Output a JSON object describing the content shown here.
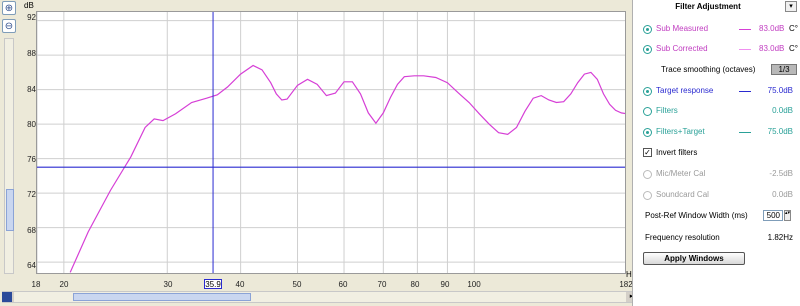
{
  "y_axis": {
    "unit": "dB",
    "ticks": [
      "92",
      "88",
      "84",
      "80",
      "76",
      "72",
      "68",
      "64"
    ]
  },
  "x_axis": {
    "unit": "Hz",
    "ticks": [
      "18",
      "20",
      "30",
      "40",
      "50",
      "60",
      "70",
      "80",
      "90",
      "100",
      "182"
    ]
  },
  "cursor_readout": "35.9",
  "chart_data": {
    "type": "line",
    "title": "",
    "xlabel": "Hz",
    "ylabel": "dB",
    "xlim": [
      18,
      182
    ],
    "ylim": [
      62.5,
      93
    ],
    "x_scale": "log",
    "series": [
      {
        "name": "Sub Measured",
        "color": "#d63fd6",
        "x": [
          20.5,
          22,
          24,
          26,
          27.5,
          28.5,
          29.5,
          31,
          33,
          35,
          36.5,
          38,
          40,
          42,
          43.5,
          45,
          46,
          47,
          48,
          50,
          52,
          54,
          56,
          58,
          60,
          62,
          64,
          66,
          68,
          70,
          72,
          74,
          76,
          79,
          82,
          86,
          90,
          94,
          98,
          102,
          106,
          110,
          114,
          118,
          122,
          126,
          130,
          134,
          138,
          142,
          146,
          150,
          154,
          158,
          162,
          166,
          170,
          174,
          178,
          182
        ],
        "y": [
          62.8,
          67.5,
          72.3,
          76.2,
          79.6,
          80.6,
          80.4,
          81.2,
          82.5,
          83.0,
          83.4,
          84.3,
          85.8,
          86.8,
          86.3,
          84.8,
          83.5,
          82.8,
          82.9,
          84.5,
          85.2,
          84.6,
          83.3,
          83.6,
          84.9,
          84.9,
          83.5,
          81.3,
          80.1,
          81.3,
          83.1,
          84.6,
          85.5,
          85.6,
          85.6,
          85.4,
          84.8,
          83.6,
          82.5,
          81.2,
          80.0,
          79.0,
          78.8,
          79.6,
          81.5,
          83.0,
          83.3,
          82.8,
          82.5,
          82.6,
          83.5,
          84.8,
          85.8,
          86.0,
          85.2,
          83.5,
          82.3,
          81.6,
          81.3,
          81.2
        ]
      },
      {
        "name": "Target response",
        "color": "#2a2ad0",
        "x": [
          18,
          182
        ],
        "y": [
          75.0,
          75.0
        ]
      }
    ],
    "cursor_x": 35.9,
    "grid": true
  },
  "panel": {
    "title": "Filter Adjustment",
    "dropdown_glyph": "▾",
    "sub_measured": {
      "label": "Sub Measured",
      "value": "83.0dB",
      "suffix": "C°",
      "color": "#d63fd6"
    },
    "sub_corrected": {
      "label": "Sub Corrected",
      "value": "83.0dB",
      "suffix": "C°",
      "color": "#f090f0"
    },
    "smoothing": {
      "label": "Trace smoothing (octaves)",
      "value": "1/3"
    },
    "target_response": {
      "label": "Target response",
      "value": "75.0dB",
      "color": "#2a2ad0"
    },
    "filters": {
      "label": "Filters",
      "value": "0.0dB",
      "color": "#2aa198"
    },
    "filters_target": {
      "label": "Filters+Target",
      "value": "75.0dB",
      "color": "#2aa198"
    },
    "invert_filters": {
      "label": "Invert filters",
      "checked": "✓"
    },
    "mic_cal": {
      "label": "Mic/Meter Cal",
      "value": "-2.5dB"
    },
    "soundcard_cal": {
      "label": "Soundcard Cal",
      "value": "0.0dB"
    },
    "post_ref": {
      "label": "Post-Ref Window Width (ms)",
      "value": "500"
    },
    "freq_res": {
      "label": "Frequency resolution",
      "value": "1.82Hz"
    },
    "apply_button": "Apply Windows"
  },
  "toolbar": {
    "lin_label": "lin"
  },
  "colors": {
    "trace": "#d63fd6",
    "target": "#2a2ad0",
    "accent": "#2aa198",
    "grid": "#cfcfcf"
  }
}
